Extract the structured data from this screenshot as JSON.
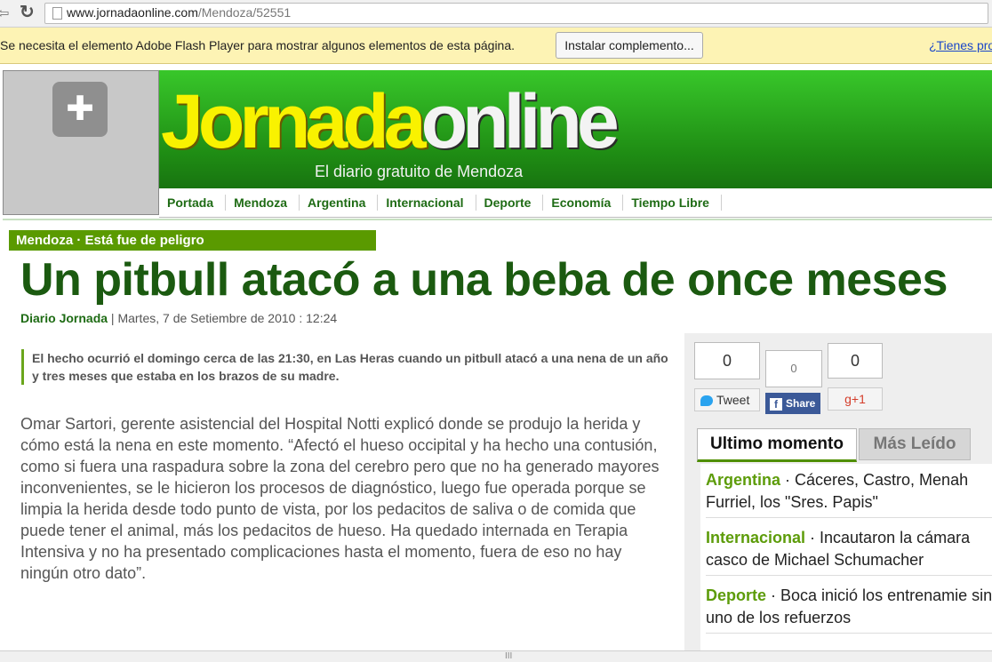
{
  "browser": {
    "url_domain": "www.jornadaonline.com",
    "url_path": "/Mendoza/52551"
  },
  "infobar": {
    "message": "Se necesita el elemento Adobe Flash Player para mostrar algunos elementos de esta página.",
    "install_button": "Instalar complemento...",
    "link": "¿Tienes pro"
  },
  "site": {
    "logo_part1": "Jornada",
    "logo_part2": "online",
    "tagline": "El diario gratuito de Mendoza",
    "menu": [
      "Portada",
      "Mendoza",
      "Argentina",
      "Internacional",
      "Deporte",
      "Economía",
      "Tiempo Libre"
    ]
  },
  "article": {
    "kicker": "Mendoza · Está fue de peligro",
    "title": "Un pitbull atacó a una beba de once meses",
    "author": "Diario Jornada",
    "date": " | Martes, 7 de Setiembre de 2010 : 12:24",
    "lead": "El hecho ocurrió el domingo cerca de las 21:30, en Las Heras cuando un pitbull atacó a una nena de un año y tres meses que estaba en los brazos de su madre.",
    "body": "Omar Sartori, gerente asistencial del Hospital Notti explicó donde se produjo la herida y cómo está la nena en este momento. “Afectó el hueso occipital y ha hecho una contusión, como si fuera una raspadura sobre la zona del cerebro pero que no ha generado mayores inconvenientes, se le hicieron los procesos de diagnóstico, luego fue operada porque se limpia la herida desde todo punto de vista, por los pedacitos de saliva o de comida que puede tener el animal, más los pedacitos de hueso. Ha quedado internada en Terapia Intensiva y no ha presentado complicaciones hasta el momento, fuera de eso no hay ningún otro dato”."
  },
  "share": {
    "tweet_count": "0",
    "tweet_label": "Tweet",
    "facebook_count": "0",
    "facebook_label": "Share",
    "gplus_count": "0",
    "gplus_label": "g+1"
  },
  "sidebar": {
    "tab_active": "Ultimo momento",
    "tab_inactive": "Más Leído",
    "news": [
      {
        "category": "Argentina",
        "text": " · Cáceres, Castro, Menah Furriel, los \"Sres. Papis\""
      },
      {
        "category": "Internacional",
        "text": " · Incautaron la cámara casco de Michael Schumacher"
      },
      {
        "category": "Deporte",
        "text": " · Boca inició los entrenamie sin uno de los refuerzos"
      }
    ]
  },
  "scrollbar": {
    "grip": "III"
  }
}
